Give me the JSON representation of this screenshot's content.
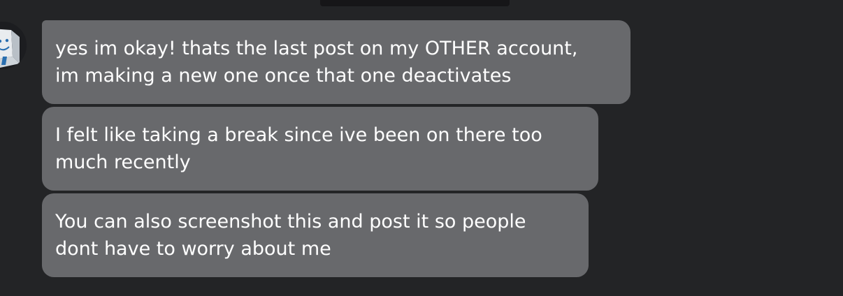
{
  "messages": [
    {
      "lines": [
        "yes im okay! thats the last post on my OTHER account,",
        "im making a new one once that one deactivates"
      ]
    },
    {
      "lines": [
        "I felt like taking a break since ive been on there too",
        "much recently"
      ]
    },
    {
      "lines": [
        "You can also screenshot this and post it so people",
        "dont have to worry about me"
      ]
    }
  ],
  "colors": {
    "background": "#232426",
    "bubble": "#68696c",
    "text": "#ffffff"
  },
  "icons": {
    "avatar": "robot-avatar-icon"
  }
}
